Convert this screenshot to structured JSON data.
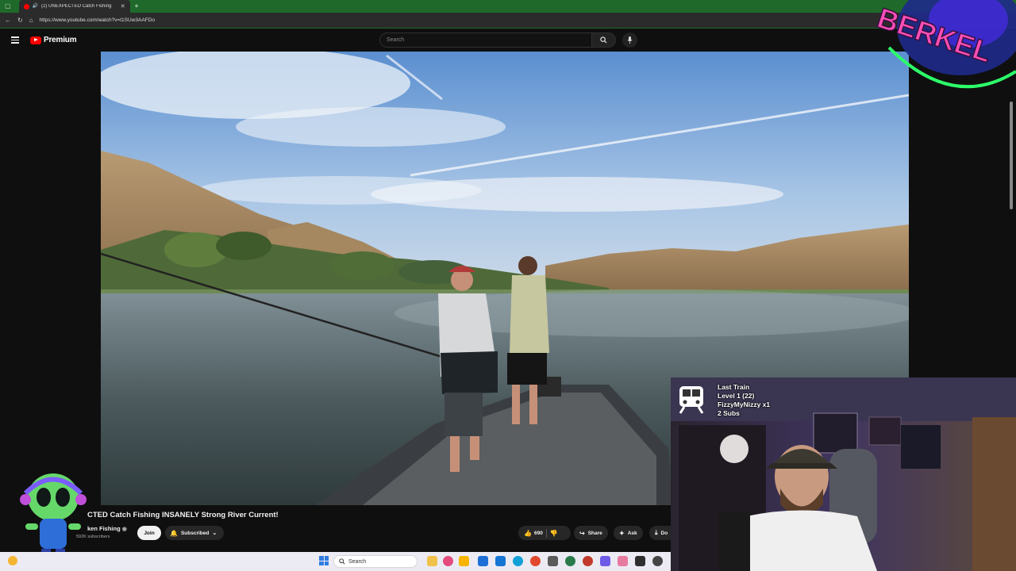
{
  "browser": {
    "tab_title": "(2) UNEXPECTED Catch Fishing",
    "url": "https://www.youtube.com/watch?v=t1SUw3AAFDo"
  },
  "masthead": {
    "logo_text": "Premium",
    "search_placeholder": "Search"
  },
  "video": {
    "title": "CTED Catch Fishing INSANELY Strong River Current!",
    "channel": "ken Fishing",
    "subscribers": "592K subscribers",
    "join_label": "Join",
    "subscribed_label": "Subscribed",
    "like_count": "690",
    "share_label": "Share",
    "ask_label": "Ask",
    "download_label": "Do"
  },
  "taskbar": {
    "search_label": "Search"
  },
  "stream_overlay": {
    "train_title": "Last Train",
    "train_level": "Level 1  (22)",
    "train_user": "FizzyMyNizzy x1",
    "train_subs": "2 Subs",
    "logo_text": "BERKEL"
  },
  "colors": {
    "tab_green": "#1f6a2a",
    "yt_red": "#ff0000",
    "bg": "#0f0f0f",
    "berkel_pink": "#ff4fb8",
    "berkel_green": "#2cff6a"
  }
}
